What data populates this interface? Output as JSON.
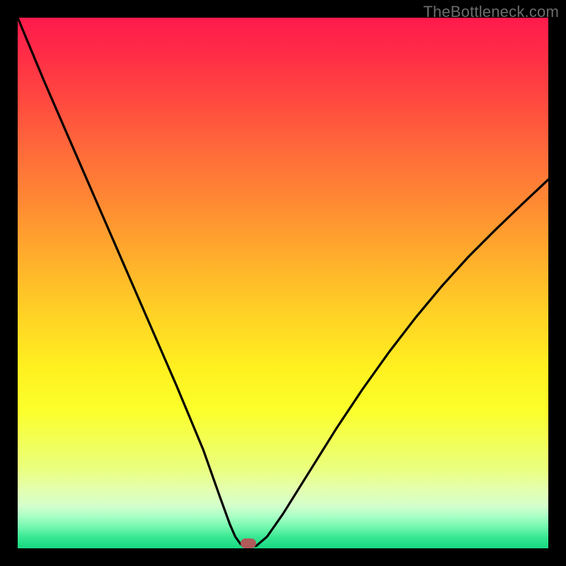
{
  "watermark": "TheBottleneck.com",
  "marker": {
    "x_pct": 43.5,
    "y_pct": 99.0,
    "color": "#b05a5a"
  },
  "chart_data": {
    "type": "line",
    "title": "",
    "xlabel": "",
    "ylabel": "",
    "xlim": [
      0,
      100
    ],
    "ylim": [
      0,
      100
    ],
    "grid": false,
    "legend": false,
    "series": [
      {
        "name": "bottleneck-curve",
        "x": [
          0,
          5,
          10,
          15,
          20,
          25,
          30,
          35,
          38,
          40,
          41,
          42,
          43,
          44,
          45,
          47,
          50,
          55,
          60,
          65,
          70,
          75,
          80,
          85,
          90,
          95,
          100
        ],
        "y": [
          100,
          88,
          76.5,
          65,
          53.5,
          42,
          30.5,
          18.5,
          10,
          4.5,
          2.2,
          0.8,
          0.3,
          0.3,
          0.5,
          2.2,
          6.5,
          14.5,
          22.5,
          30,
          37,
          43.5,
          49.5,
          55,
          60,
          64.8,
          69.5
        ]
      }
    ],
    "annotations": [
      {
        "type": "marker",
        "x": 43.5,
        "y": 0.3,
        "label": "optimal-point"
      }
    ],
    "background_gradient": {
      "direction": "vertical",
      "stops": [
        {
          "pct": 0,
          "color": "#ff1a4d"
        },
        {
          "pct": 25,
          "color": "#ff6a3a"
        },
        {
          "pct": 50,
          "color": "#ffc028"
        },
        {
          "pct": 72,
          "color": "#fdff24"
        },
        {
          "pct": 88,
          "color": "#eaff90"
        },
        {
          "pct": 100,
          "color": "#17d883"
        }
      ]
    }
  }
}
